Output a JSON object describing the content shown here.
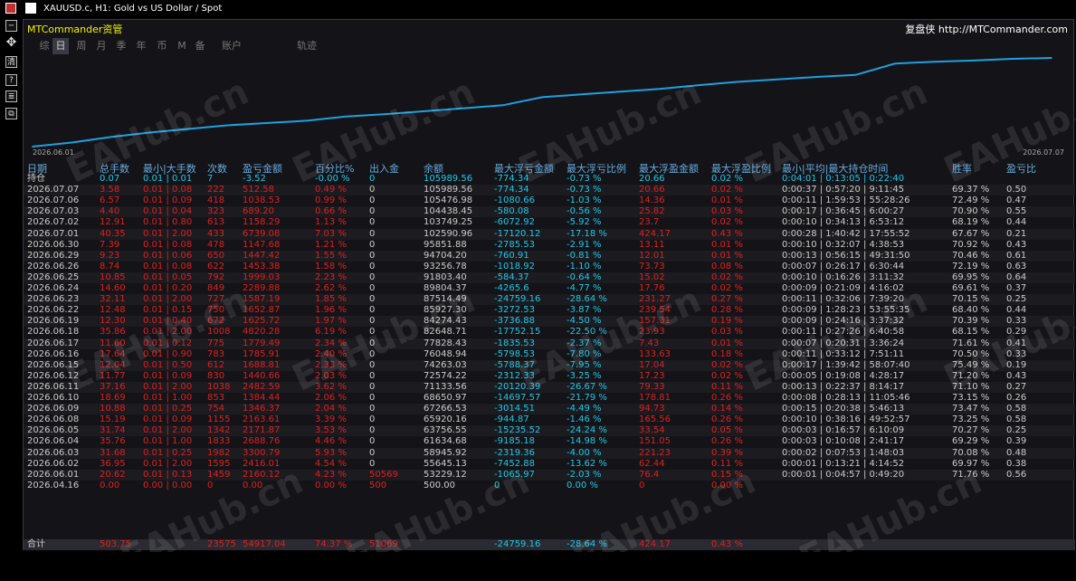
{
  "window": {
    "title": "XAUUSD.c, H1:  Gold vs US Dollar / Spot"
  },
  "brand": {
    "left": "MTCommander资管",
    "right": "复盘侠 http://MTCommander.com"
  },
  "tabs": [
    "综",
    "日",
    "周",
    "月",
    "季",
    "年",
    "币",
    "M",
    "备",
    "账户",
    "轨迹"
  ],
  "active_tab": "日",
  "chart_data": {
    "type": "line",
    "x": [
      "2026.06.01",
      "2026.06.02",
      "2026.06.03",
      "2026.06.04",
      "2026.06.05",
      "2026.06.08",
      "2026.06.09",
      "2026.06.10",
      "2026.06.11",
      "2026.06.12",
      "2026.06.15",
      "2026.06.16",
      "2026.06.17",
      "2026.06.18",
      "2026.06.19",
      "2026.06.22",
      "2026.06.23",
      "2026.06.24",
      "2026.06.25",
      "2026.06.26",
      "2026.06.29",
      "2026.06.30",
      "2026.07.01",
      "2026.07.02",
      "2026.07.03",
      "2026.07.06",
      "2026.07.07"
    ],
    "values": [
      53229.12,
      55645.13,
      58945.92,
      61634.68,
      63756.55,
      65920.16,
      67266.53,
      68650.97,
      71133.56,
      72574.22,
      74263.03,
      76048.94,
      77828.43,
      82648.71,
      84274.43,
      85927.3,
      87514.49,
      89804.37,
      91803.4,
      93256.78,
      94704.2,
      95851.88,
      102590.96,
      103749.25,
      104438.45,
      105476.98,
      105989.56
    ],
    "xlabel_start": "2026.06.01",
    "xlabel_end": "2026.07.07",
    "color": "#1ea0e0"
  },
  "table": {
    "headers": [
      "日期",
      "总手数",
      "最小|大手数",
      "次数",
      "盈亏金额",
      "百分比%",
      "出入金",
      "余额",
      "最大浮亏金额",
      "最大浮亏比例",
      "最大浮盈金额",
      "最大浮盈比例",
      "最小|平均|最大持仓时间",
      "胜率",
      "盈亏比"
    ],
    "holding": [
      "持仓",
      "0.07",
      "0.01 | 0.01",
      "7",
      "-3.52",
      "-0.00 %",
      "0",
      "105989.56",
      "-774.34",
      "-0.73 %",
      "20.66",
      "0.02 %",
      "0:04:01 | 0:13:05 | 0:22:40",
      "",
      ""
    ],
    "rows": [
      [
        "2026.07.07",
        "3.58",
        "0.01 | 0.08",
        "222",
        "512.58",
        "0.49 %",
        "0",
        "105989.56",
        "-774.34",
        "-0.73 %",
        "20.66",
        "0.02 %",
        "0:00:37 | 0:57:20 | 9:11:45",
        "69.37 %",
        "0.50"
      ],
      [
        "2026.07.06",
        "6.57",
        "0.01 | 0.09",
        "418",
        "1038.53",
        "0.99 %",
        "0",
        "105476.98",
        "-1080.66",
        "-1.03 %",
        "14.36",
        "0.01 %",
        "0:00:11 | 1:59:53 | 55:28:26",
        "72.49 %",
        "0.47"
      ],
      [
        "2026.07.03",
        "4.40",
        "0.01 | 0.04",
        "323",
        "689.20",
        "0.66 %",
        "0",
        "104438.45",
        "-580.08",
        "-0.56 %",
        "25.82",
        "0.03 %",
        "0:00:17 | 0:36:45 | 6:00:27",
        "70.90 %",
        "0.55"
      ],
      [
        "2026.07.02",
        "12.91",
        "0.01 | 0.80",
        "613",
        "1158.29",
        "1.13 %",
        "0",
        "103749.25",
        "-6072.92",
        "-5.92 %",
        "23.7",
        "0.02 %",
        "0:00:10 | 0:34:13 | 6:53:12",
        "68.19 %",
        "0.44"
      ],
      [
        "2026.07.01",
        "40.35",
        "0.01 | 2.00",
        "433",
        "6739.08",
        "7.03 %",
        "0",
        "102590.96",
        "-17120.12",
        "-17.18 %",
        "424.17",
        "0.43 %",
        "0:00:28 | 1:40:42 | 17:55:52",
        "67.67 %",
        "0.21"
      ],
      [
        "2026.06.30",
        "7.39",
        "0.01 | 0.08",
        "478",
        "1147.68",
        "1.21 %",
        "0",
        "95851.88",
        "-2785.53",
        "-2.91 %",
        "13.11",
        "0.01 %",
        "0:00:10 | 0:32:07 | 4:38:53",
        "70.92 %",
        "0.43"
      ],
      [
        "2026.06.29",
        "9.23",
        "0.01 | 0.06",
        "650",
        "1447.42",
        "1.55 %",
        "0",
        "94704.20",
        "-760.91",
        "-0.81 %",
        "12.01",
        "0.01 %",
        "0:00:13 | 0:56:15 | 49:31:50",
        "70.46 %",
        "0.61"
      ],
      [
        "2026.06.26",
        "8.74",
        "0.01 | 0.08",
        "622",
        "1453.38",
        "1.58 %",
        "0",
        "93256.78",
        "-1018.92",
        "-1.10 %",
        "73.73",
        "0.08 %",
        "0:00:07 | 0:26:17 | 6:30:44",
        "72.19 %",
        "0.63"
      ],
      [
        "2026.06.25",
        "10.85",
        "0.01 | 0.05",
        "792",
        "1999.03",
        "2.23 %",
        "0",
        "91803.40",
        "-584.37",
        "-0.64 %",
        "15.02",
        "0.02 %",
        "0:00:10 | 0:16:26 | 3:11:32",
        "69.95 %",
        "0.64"
      ],
      [
        "2026.06.24",
        "14.60",
        "0.01 | 0.20",
        "849",
        "2289.88",
        "2.62 %",
        "0",
        "89804.37",
        "-4265.6",
        "-4.77 %",
        "17.76",
        "0.02 %",
        "0:00:09 | 0:21:09 | 4:16:02",
        "69.61 %",
        "0.37"
      ],
      [
        "2026.06.23",
        "32.11",
        "0.01 | 2.00",
        "727",
        "1587.19",
        "1.85 %",
        "0",
        "87514.49",
        "-24759.16",
        "-28.64 %",
        "231.27",
        "0.27 %",
        "0:00:11 | 0:32:06 | 7:39:20",
        "70.15 %",
        "0.25"
      ],
      [
        "2026.06.22",
        "12.48",
        "0.01 | 0.15",
        "750",
        "1652.87",
        "1.96 %",
        "0",
        "85927.30",
        "-3272.53",
        "-3.87 %",
        "239.54",
        "0.28 %",
        "0:00:09 | 1:28:23 | 53:55:35",
        "68.40 %",
        "0.44"
      ],
      [
        "2026.06.19",
        "12.30",
        "0.01 | 0.40",
        "672",
        "1625.72",
        "1.97 %",
        "0",
        "84274.43",
        "-3736.88",
        "-4.50 %",
        "157.31",
        "0.19 %",
        "0:00:09 | 0:24:16 | 3:37:32",
        "70.39 %",
        "0.33"
      ],
      [
        "2026.06.18",
        "35.86",
        "0.01 | 2.00",
        "1008",
        "4820.28",
        "6.19 %",
        "0",
        "82648.71",
        "-17752.15",
        "-22.50 %",
        "23.93",
        "0.03 %",
        "0:00:11 | 0:27:26 | 6:40:58",
        "68.15 %",
        "0.29"
      ],
      [
        "2026.06.17",
        "11.60",
        "0.01 | 0.12",
        "775",
        "1779.49",
        "2.34 %",
        "0",
        "77828.43",
        "-1835.53",
        "-2.37 %",
        "7.43",
        "0.01 %",
        "0:00:07 | 0:20:31 | 3:36:24",
        "71.61 %",
        "0.41"
      ],
      [
        "2026.06.16",
        "17.64",
        "0.01 | 0.90",
        "783",
        "1785.91",
        "2.40 %",
        "0",
        "76048.94",
        "-5798.53",
        "-7.80 %",
        "133.63",
        "0.18 %",
        "0:00:11 | 0:33:12 | 7:51:11",
        "70.50 %",
        "0.33"
      ],
      [
        "2026.06.15",
        "12.04",
        "0.01 | 0.50",
        "612",
        "1688.81",
        "2.33 %",
        "0",
        "74263.03",
        "-5788.37",
        "-7.95 %",
        "17.04",
        "0.02 %",
        "0:00:17 | 1:39:42 | 58:07:40",
        "75.49 %",
        "0.19"
      ],
      [
        "2026.06.12",
        "11.77",
        "0.01 | 0.09",
        "830",
        "1440.66",
        "2.03 %",
        "0",
        "72574.22",
        "-2312.33",
        "-3.25 %",
        "17.23",
        "0.02 %",
        "0:00:05 | 0:19:08 | 4:28:17",
        "71.20 %",
        "0.43"
      ],
      [
        "2026.06.11",
        "37.16",
        "0.01 | 2.00",
        "1038",
        "2482.59",
        "3.62 %",
        "0",
        "71133.56",
        "-20120.39",
        "-26.67 %",
        "79.33",
        "0.11 %",
        "0:00:13 | 0:22:37 | 8:14:17",
        "71.10 %",
        "0.27"
      ],
      [
        "2026.06.10",
        "18.69",
        "0.01 | 1.00",
        "853",
        "1384.44",
        "2.06 %",
        "0",
        "68650.97",
        "-14697.57",
        "-21.79 %",
        "178.81",
        "0.26 %",
        "0:00:08 | 0:28:13 | 11:05:46",
        "73.15 %",
        "0.26"
      ],
      [
        "2026.06.09",
        "10.88",
        "0.01 | 0.25",
        "754",
        "1346.37",
        "2.04 %",
        "0",
        "67266.53",
        "-3014.51",
        "-4.49 %",
        "94.73",
        "0.14 %",
        "0:00:15 | 0:20:38 | 5:46:13",
        "73.47 %",
        "0.58"
      ],
      [
        "2026.06.08",
        "15.19",
        "0.01 | 0.09",
        "1155",
        "2163.61",
        "3.39 %",
        "0",
        "65920.16",
        "-944.87",
        "-1.46 %",
        "165.56",
        "0.26 %",
        "0:00:10 | 0:38:16 | 49:52:57",
        "73.25 %",
        "0.58"
      ],
      [
        "2026.06.05",
        "31.74",
        "0.01 | 2.00",
        "1342",
        "2171.87",
        "3.53 %",
        "0",
        "63756.55",
        "-15235.52",
        "-24.24 %",
        "33.54",
        "0.05 %",
        "0:00:03 | 0:16:57 | 6:10:09",
        "70.27 %",
        "0.25"
      ],
      [
        "2026.06.04",
        "35.76",
        "0.01 | 1.00",
        "1833",
        "2688.76",
        "4.46 %",
        "0",
        "61634.68",
        "-9185.18",
        "-14.98 %",
        "151.05",
        "0.26 %",
        "0:00:03 | 0:10:08 | 2:41:17",
        "69.29 %",
        "0.39"
      ],
      [
        "2026.06.03",
        "31.68",
        "0.01 | 0.25",
        "1982",
        "3300.79",
        "5.93 %",
        "0",
        "58945.92",
        "-2319.36",
        "-4.00 %",
        "221.23",
        "0.39 %",
        "0:00:02 | 0:07:53 | 1:48:03",
        "70.08 %",
        "0.48"
      ],
      [
        "2026.06.02",
        "36.95",
        "0.01 | 2.00",
        "1595",
        "2416.01",
        "4.54 %",
        "0",
        "55645.13",
        "-7452.88",
        "-13.62 %",
        "62.44",
        "0.11 %",
        "0:00:01 | 0:13:21 | 4:14:52",
        "69.97 %",
        "0.38"
      ],
      [
        "2026.06.01",
        "20.62",
        "0.01 | 0.13",
        "1459",
        "2160.12",
        "4.23 %",
        "50569",
        "53229.12",
        "-1065.97",
        "-2.03 %",
        "76.4",
        "0.15 %",
        "0:00:01 | 0:04:57 | 0:49:20",
        "71.76 %",
        "0.56"
      ],
      [
        "2026.04.16",
        "0.00",
        "0.00 | 0.00",
        "0",
        "0.00",
        "0.00 %",
        "500",
        "500.00",
        "0",
        "0.00 %",
        "0",
        "0.00 %",
        "",
        "",
        ""
      ]
    ],
    "total": [
      "合计",
      "503.75",
      "",
      "23575",
      "54917.04",
      "74.37 %",
      "51069",
      "",
      "-24759.16",
      "-28.64 %",
      "424.17",
      "0.43 %",
      "",
      "",
      ""
    ]
  },
  "watermark": "EAHub.cn"
}
